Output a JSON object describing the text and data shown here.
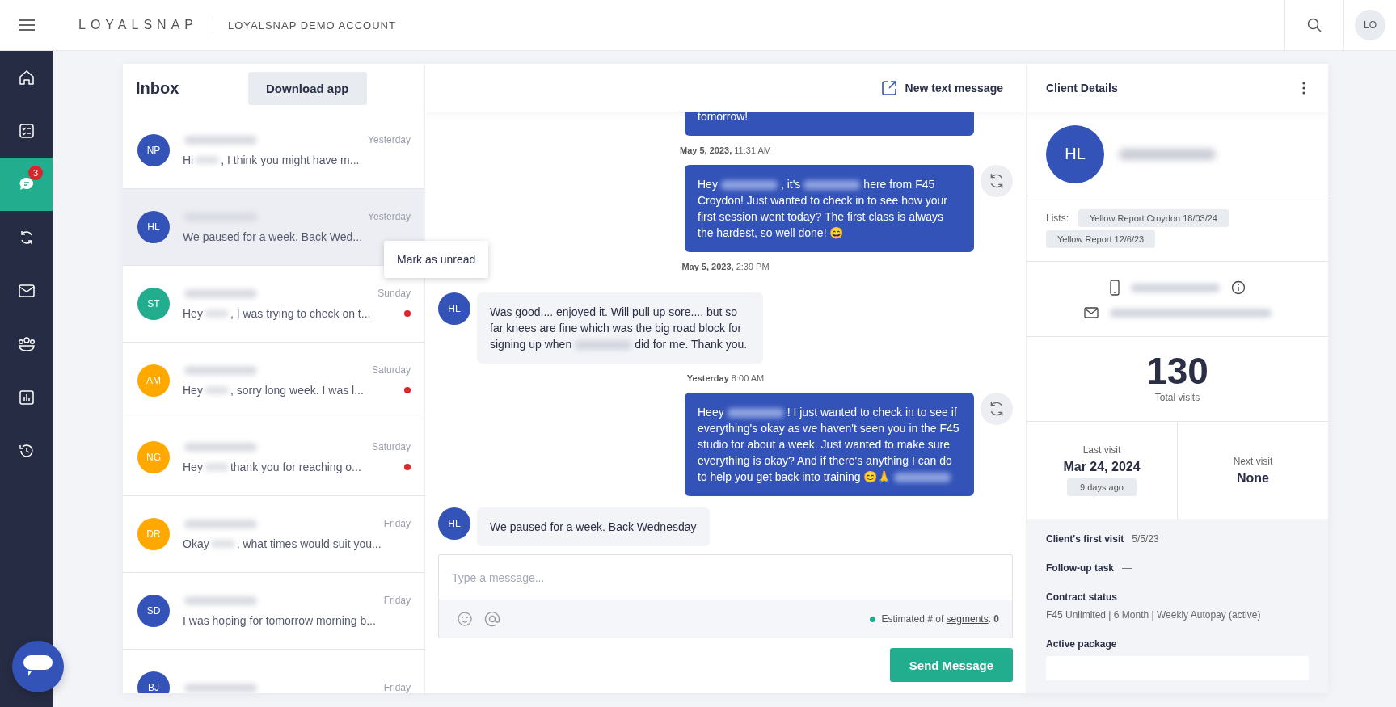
{
  "topbar": {
    "brand": "LOYALSNAP",
    "account": "LOYALSNAP DEMO ACCOUNT",
    "avatar": "LO"
  },
  "nav": [
    {
      "kind": "home",
      "selected": false
    },
    {
      "kind": "tasks",
      "selected": false
    },
    {
      "kind": "chat",
      "selected": true,
      "badge": "3"
    },
    {
      "kind": "sync",
      "selected": false
    },
    {
      "kind": "mail",
      "selected": false
    },
    {
      "kind": "people",
      "selected": false
    },
    {
      "kind": "chart",
      "selected": false
    },
    {
      "kind": "history",
      "selected": false
    }
  ],
  "inbox": {
    "title": "Inbox",
    "download_button": "Download app",
    "conversations": [
      {
        "initials": "NP",
        "color": "#3353b8",
        "time": "Yesterday",
        "unread": false,
        "selected": false,
        "preview": [
          {
            "kind": "text",
            "text": "Hi"
          },
          {
            "kind": "redacted"
          },
          {
            "kind": "text",
            "text": ", I think you might have m..."
          }
        ]
      },
      {
        "initials": "HL",
        "color": "#3353b8",
        "time": "Yesterday",
        "unread": false,
        "selected": true,
        "preview": [
          {
            "kind": "text",
            "text": "We paused for a week. Back Wed..."
          }
        ]
      },
      {
        "initials": "ST",
        "color": "#22ad8f",
        "time": "Sunday",
        "unread": true,
        "selected": false,
        "preview": [
          {
            "kind": "text",
            "text": "Hey"
          },
          {
            "kind": "redacted"
          },
          {
            "kind": "text",
            "text": ", I was trying to check on t..."
          }
        ]
      },
      {
        "initials": "AM",
        "color": "#ffa800",
        "time": "Saturday",
        "unread": true,
        "selected": false,
        "preview": [
          {
            "kind": "text",
            "text": "Hey"
          },
          {
            "kind": "redacted"
          },
          {
            "kind": "text",
            "text": ", sorry long week. I was l..."
          }
        ]
      },
      {
        "initials": "NG",
        "color": "#ffa800",
        "time": "Saturday",
        "unread": true,
        "selected": false,
        "preview": [
          {
            "kind": "text",
            "text": "Hey"
          },
          {
            "kind": "redacted"
          },
          {
            "kind": "text",
            "text": "thank you for reaching o..."
          }
        ]
      },
      {
        "initials": "DR",
        "color": "#ffa800",
        "time": "Friday",
        "unread": false,
        "selected": false,
        "preview": [
          {
            "kind": "text",
            "text": "Okay"
          },
          {
            "kind": "redacted"
          },
          {
            "kind": "text",
            "text": ", what times would suit you..."
          }
        ]
      },
      {
        "initials": "SD",
        "color": "#3353b8",
        "time": "Friday",
        "unread": false,
        "selected": false,
        "preview": [
          {
            "kind": "text",
            "text": "I was hoping for tomorrow morning b..."
          }
        ]
      },
      {
        "initials": "BJ",
        "color": "#3353b8",
        "time": "Friday",
        "selected": false
      }
    ]
  },
  "context_menu": {
    "item": "Mark as unread"
  },
  "chat": {
    "new_message": "New text message",
    "messages": [
      {
        "kind": "outgoing",
        "resend": false,
        "segments": [
          {
            "kind": "text",
            "text": "tomorrow!"
          }
        ]
      },
      {
        "kind": "timestamp",
        "date": "May 5, 2023,",
        "time": "11:31 AM"
      },
      {
        "kind": "outgoing",
        "resend": true,
        "segments": [
          {
            "kind": "text",
            "text": "Hey"
          },
          {
            "kind": "redacted"
          },
          {
            "kind": "text",
            "text": ", it's"
          },
          {
            "kind": "redacted"
          },
          {
            "kind": "text",
            "text": "here from F45 Croydon! Just wanted to check in to see how your first session went today? The first class is always the hardest, so well done! 😄"
          }
        ]
      },
      {
        "kind": "timestamp",
        "date": "May 5, 2023,",
        "time": "2:39 PM"
      },
      {
        "kind": "incoming",
        "initials": "HL",
        "segments": [
          {
            "kind": "text",
            "text": "Was good.... enjoyed it. Will pull up sore.... but so far knees are fine which was the big road block for signing up when"
          },
          {
            "kind": "redacted"
          },
          {
            "kind": "text",
            "text": "did for me. Thank you."
          }
        ]
      },
      {
        "kind": "timestamp",
        "date": "Yesterday",
        "time": "8:00 AM"
      },
      {
        "kind": "outgoing",
        "resend": true,
        "segments": [
          {
            "kind": "text",
            "text": "Heey"
          },
          {
            "kind": "redacted"
          },
          {
            "kind": "text",
            "text": "! I just wanted to check in to see if everything's okay as we haven't seen you in the F45 studio for about a week. Just wanted to make sure everything is okay? And if there's anything I can do to help you get back into training 😊🙏"
          },
          {
            "kind": "redacted"
          }
        ]
      },
      {
        "kind": "incoming",
        "initials": "HL",
        "segments": [
          {
            "kind": "text",
            "text": "We paused for a week. Back Wednesday"
          }
        ]
      }
    ],
    "composer": {
      "placeholder": "Type a message...",
      "segments_label": "Estimated # of",
      "segments_link": "segments",
      "segments_colon": ":",
      "segments_count": "0"
    },
    "send_button": "Send Message"
  },
  "client": {
    "title": "Client Details",
    "initials": "HL",
    "lists_label": "Lists:",
    "lists": [
      "Yellow Report Croydon 18/03/24",
      "Yellow Report 12/6/23"
    ],
    "total_visits": "130",
    "total_visits_label": "Total visits",
    "last_visit_label": "Last visit",
    "last_visit": "Mar 24, 2024",
    "last_visit_ago": "9 days ago",
    "next_visit_label": "Next visit",
    "next_visit": "None",
    "first_visit_label": "Client's first visit",
    "first_visit": "5/5/23",
    "follow_up_label": "Follow-up task",
    "follow_up": "—",
    "contract_label": "Contract status",
    "contract": "F45 Unlimited | 6 Month | Weekly Autopay (active)",
    "package_label": "Active package"
  }
}
